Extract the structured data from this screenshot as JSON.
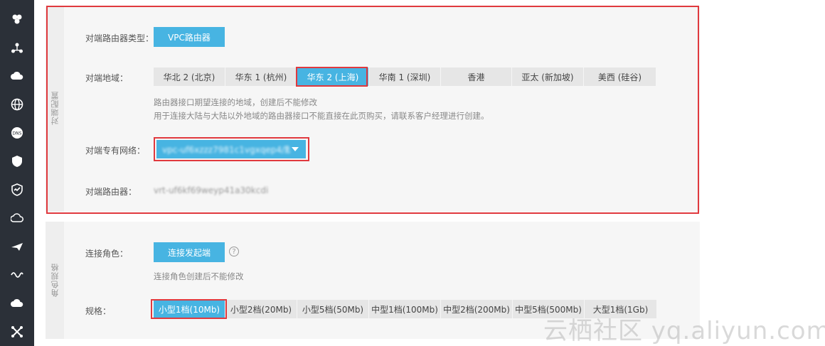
{
  "sidebar": {
    "icons": [
      "cluster-icon",
      "network-icon",
      "cloud-upload-icon",
      "globe-icon",
      "dns-icon",
      "shield-icon",
      "monitor-icon",
      "cloud-icon",
      "plane-icon",
      "wave-icon",
      "cloud-share-icon",
      "cross-icon"
    ]
  },
  "peer_config": {
    "section_label": "对端配置",
    "router_type_label": "对端路由器类型：",
    "router_type_value": "VPC路由器",
    "region_label": "对端地域：",
    "regions": [
      "华北 2 (北京)",
      "华东 1 (杭州)",
      "华东 2 (上海)",
      "华南 1 (深圳)",
      "香港",
      "亚太 (新加坡)",
      "美西 (硅谷)"
    ],
    "selected_region": "华东 2 (上海)",
    "region_hint_1": "路由器接口期望连接的地域，创建后不能修改",
    "region_hint_2": "用于连接大陆与大陆以外地域的路由器接口不能直接在此页购买，请联系客户经理进行创建。",
    "vpc_label": "对端专有网络：",
    "vpc_value": "vpc-uf6xzzz7981c1vgxqep4/默...",
    "router_label": "对端路由器：",
    "router_value": "vrt-uf6kf69weyp41a30kcdi"
  },
  "role_spec": {
    "section_label": "角色规格",
    "role_label": "连接角色：",
    "role_value": "连接发起端",
    "help_glyph": "?",
    "role_hint": "连接角色创建后不能修改",
    "spec_label": "规格：",
    "specs": [
      "小型1档(10Mb)",
      "小型2档(20Mb)",
      "小型5档(50Mb)",
      "中型1档(100Mb)",
      "中型2档(200Mb)",
      "中型5档(500Mb)",
      "大型1档(1Gb)"
    ],
    "selected_spec": "小型1档(10Mb)"
  },
  "watermark": "云栖社区 yq.aliyun.com",
  "colors": {
    "accent": "#47b4e2",
    "highlight": "#e0393e",
    "sidebar": "#2b3038"
  }
}
